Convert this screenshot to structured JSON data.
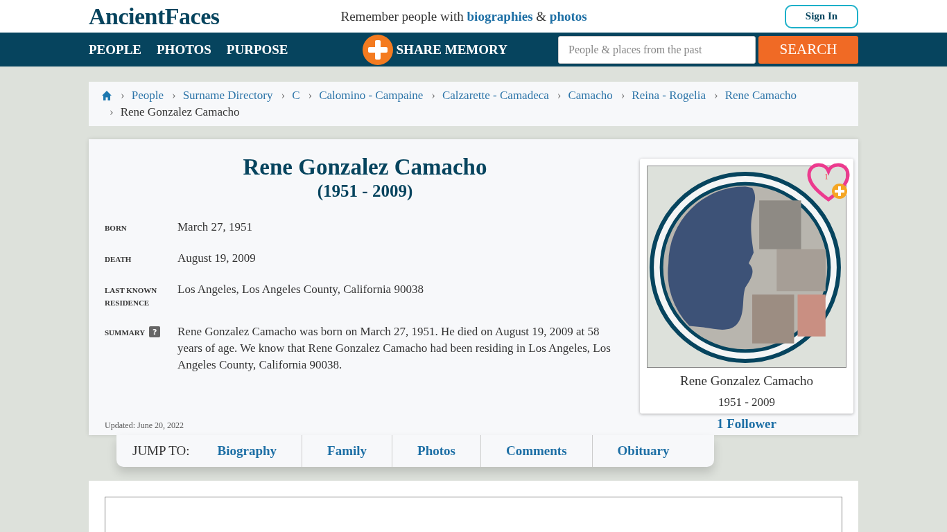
{
  "header": {
    "logo": "AncientFaces",
    "tagline": [
      {
        "text": "Remember people with ",
        "link": false
      },
      {
        "text": "biographies",
        "link": true
      },
      {
        "text": " & ",
        "link": false
      },
      {
        "text": "photos",
        "link": true
      }
    ],
    "sign_in": "Sign In"
  },
  "nav": {
    "items": [
      "PEOPLE",
      "PHOTOS",
      "PURPOSE"
    ],
    "share": "SHARE MEMORY",
    "search": {
      "placeholder": "People & places from the past",
      "button": "SEARCH"
    }
  },
  "breadcrumbs": [
    {
      "sep": "›",
      "label": "People",
      "link": true
    },
    {
      "sep": "›",
      "label": "Surname Directory",
      "link": true
    },
    {
      "sep": "›",
      "label": "C",
      "link": true
    },
    {
      "sep": "›",
      "label": "Calomino - Campaine",
      "link": true
    },
    {
      "sep": "›",
      "label": "Calzarette - Camadeca",
      "link": true
    },
    {
      "sep": "›",
      "label": "Camacho",
      "link": true
    },
    {
      "sep": "›",
      "label": "Reina - Rogelia",
      "link": true
    },
    {
      "sep": "›",
      "label": "Rene Camacho",
      "link": true
    },
    {
      "sep": "›",
      "label": "Rene Gonzalez Camacho",
      "link": false
    }
  ],
  "profile": {
    "name": "Rene Gonzalez Camacho",
    "years": "(1951 - 2009)",
    "facts": [
      {
        "label": "BORN",
        "value": "March 27, 1951",
        "help": false
      },
      {
        "label": "DEATH",
        "value": "August 19, 2009",
        "help": false
      },
      {
        "label": "LAST KNOWN RESIDENCE",
        "value": "Los Angeles, Los Angeles County, California 90038",
        "help": false
      },
      {
        "label": "SUMMARY",
        "value": "Rene Gonzalez Camacho was born on March 27, 1951. He died on August 19, 2009 at 58 years of age. We know that Rene Gonzalez Camacho had been residing in Los Angeles, Los Angeles County, California 90038.",
        "help": true,
        "help_mark": "?"
      }
    ],
    "updated": "Updated: June 20, 2022",
    "card": {
      "kind": "picture",
      "follow_count": "1",
      "name": "Rene Gonzalez Camacho",
      "years": "1951 - 2009"
    },
    "followers": "1 Follower"
  },
  "jump": {
    "label": "JUMP TO:",
    "links": [
      "Biography",
      "Family",
      "Photos",
      "Comments",
      "Obituary"
    ]
  }
}
